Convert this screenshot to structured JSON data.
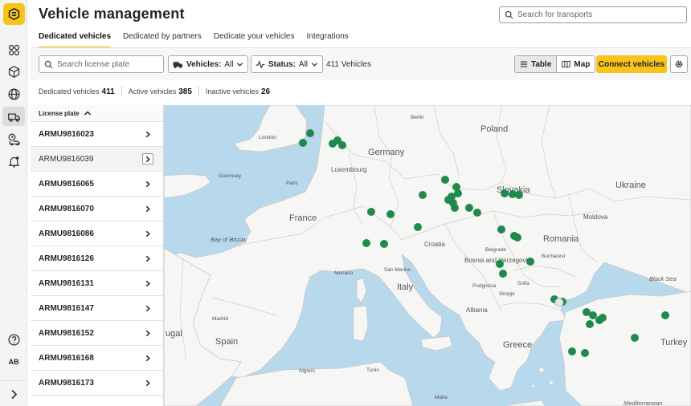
{
  "app": {
    "title": "Vehicle management",
    "search_placeholder": "Search for transports",
    "user_initials": "AB"
  },
  "tabs": [
    {
      "label": "Dedicated vehicles",
      "active": true
    },
    {
      "label": "Dedicated by partners"
    },
    {
      "label": "Dedicate your vehicles"
    },
    {
      "label": "Integrations"
    }
  ],
  "toolbar": {
    "plate_placeholder": "Search license plate",
    "vehicles_filter": {
      "label": "Vehicles:",
      "value": "All"
    },
    "status_filter": {
      "label": "Status:",
      "value": "All"
    },
    "count": "411 Vehicles",
    "view_table": "Table",
    "view_map": "Map",
    "connect": "Connect vehicles"
  },
  "stats": {
    "dedicated_label": "Dedicated vehicles",
    "dedicated": "411",
    "active_label": "Active vehicles",
    "active": "385",
    "inactive_label": "Inactive vehicles",
    "inactive": "26"
  },
  "list": {
    "header": "License plate",
    "rows": [
      "ARMU9816023",
      "ARMU9816039",
      "ARMU9816065",
      "ARMU9816070",
      "ARMU9816086",
      "ARMU9816126",
      "ARMU9816131",
      "ARMU9816147",
      "ARMU9816152",
      "ARMU9816168",
      "ARMU9816173"
    ]
  },
  "map": {
    "colors": {
      "water": "#b8d8ec",
      "land": "#f6f6f4",
      "border": "#c9c9c9",
      "marker": "#1f8a4c"
    },
    "countries": [
      {
        "name": "Poland",
        "size": "large"
      },
      {
        "name": "Germany",
        "size": "large"
      },
      {
        "name": "Slovakia",
        "size": "large"
      },
      {
        "name": "Ukraine",
        "size": "large"
      },
      {
        "name": "France",
        "size": "large"
      },
      {
        "name": "Romania",
        "size": "large"
      },
      {
        "name": "Italy",
        "size": "large"
      },
      {
        "name": "Spain",
        "size": "large"
      },
      {
        "name": "Greece",
        "size": "large"
      },
      {
        "name": "Turkey",
        "size": "large"
      },
      {
        "name": "Croatia",
        "size": "mid"
      },
      {
        "name": "Bosnia and Herzegovina",
        "size": "mid"
      },
      {
        "name": "Moldova",
        "size": "mid"
      },
      {
        "name": "Albania",
        "size": "mid"
      },
      {
        "name": "Luxembourg",
        "size": "mid"
      },
      {
        "name": "ugal",
        "size": "large"
      }
    ],
    "cities": [
      "London",
      "Berlin",
      "Paris",
      "Guernsey",
      "Belgrade",
      "Bucharest",
      "Sofia",
      "Skopje",
      "Podgorica",
      "San Marino",
      "Monaco",
      "Madrid",
      "Algiers",
      "Tunis",
      "Malta"
    ],
    "seas": [
      "Bay of Biscay",
      "Black Sea",
      "Mediterranean"
    ]
  }
}
